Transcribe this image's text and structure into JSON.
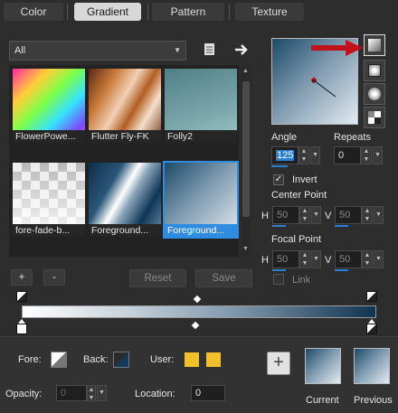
{
  "tabs": [
    {
      "label": "Color",
      "active": false
    },
    {
      "label": "Gradient",
      "active": true
    },
    {
      "label": "Pattern",
      "active": false
    },
    {
      "label": "Texture",
      "active": false
    }
  ],
  "filter": {
    "value": "All"
  },
  "thumbnails": [
    {
      "label": "FlowerPowe..."
    },
    {
      "label": "Flutter Fly-FK"
    },
    {
      "label": "Folly2"
    },
    {
      "label": "fore-fade-b..."
    },
    {
      "label": "Foreground..."
    },
    {
      "label": "Foreground...",
      "selected": true
    }
  ],
  "actions": {
    "add": "+",
    "remove": "-",
    "reset": "Reset",
    "save": "Save"
  },
  "angle": {
    "label": "Angle",
    "value": "125"
  },
  "repeats": {
    "label": "Repeats",
    "value": "0"
  },
  "invert": {
    "label": "Invert",
    "checked": true
  },
  "center_point": {
    "label": "Center Point",
    "h_label": "H",
    "h": "50",
    "v_label": "V",
    "v": "50"
  },
  "focal_point": {
    "label": "Focal Point",
    "h_label": "H",
    "h": "50",
    "v_label": "V",
    "v": "50"
  },
  "link": {
    "label": "Link",
    "checked": false
  },
  "bottom": {
    "fore_label": "Fore:",
    "back_label": "Back:",
    "user_label": "User:",
    "opacity_label": "Opacity:",
    "opacity_value": "0",
    "location_label": "Location:",
    "location_value": "0",
    "current_label": "Current",
    "previous_label": "Previous",
    "add": "+"
  },
  "colors": {
    "accent": "#2e8de0",
    "user": "#f2c02b",
    "arrow": "#c0121a",
    "back": "#153a5c"
  }
}
